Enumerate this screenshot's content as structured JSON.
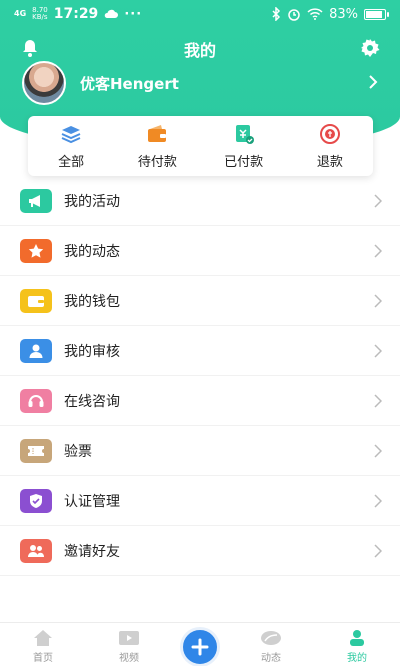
{
  "status_bar": {
    "network": "4G",
    "speed_value": "8.70",
    "speed_unit": "KB/s",
    "time": "17:29",
    "more": "···",
    "battery": "83%"
  },
  "header": {
    "title": "我的"
  },
  "profile": {
    "username": "优客Hengert"
  },
  "orders": [
    {
      "label": "全部",
      "icon": "layers-icon",
      "color": "#4a90e2"
    },
    {
      "label": "待付款",
      "icon": "wallet-icon",
      "color": "#f08a24"
    },
    {
      "label": "已付款",
      "icon": "paid-icon",
      "color": "#2cc9a0"
    },
    {
      "label": "退款",
      "icon": "refund-icon",
      "color": "#e64a4a"
    }
  ],
  "menu": [
    {
      "label": "我的活动",
      "icon": "megaphone-icon",
      "color": "#2cc9a0"
    },
    {
      "label": "我的动态",
      "icon": "star-icon",
      "color": "#f26b2c"
    },
    {
      "label": "我的钱包",
      "icon": "wallet-icon",
      "color": "#f5c21b"
    },
    {
      "label": "我的审核",
      "icon": "user-icon",
      "color": "#3b8fe6"
    },
    {
      "label": "在线咨询",
      "icon": "headset-icon",
      "color": "#f07fa2"
    },
    {
      "label": "验票",
      "icon": "ticket-icon",
      "color": "#c7a67a"
    },
    {
      "label": "认证管理",
      "icon": "shield-check-icon",
      "color": "#8b4fd1"
    },
    {
      "label": "邀请好友",
      "icon": "users-icon",
      "color": "#ef6a5a"
    }
  ],
  "nav": [
    {
      "label": "首页",
      "icon": "home-icon"
    },
    {
      "label": "视频",
      "icon": "video-icon"
    },
    {
      "label": "",
      "icon": "plus-icon"
    },
    {
      "label": "动态",
      "icon": "feed-icon"
    },
    {
      "label": "我的",
      "icon": "profile-icon",
      "active": true
    }
  ],
  "colors": {
    "brand": "#2cc9a0",
    "plus": "#2f86e8"
  }
}
